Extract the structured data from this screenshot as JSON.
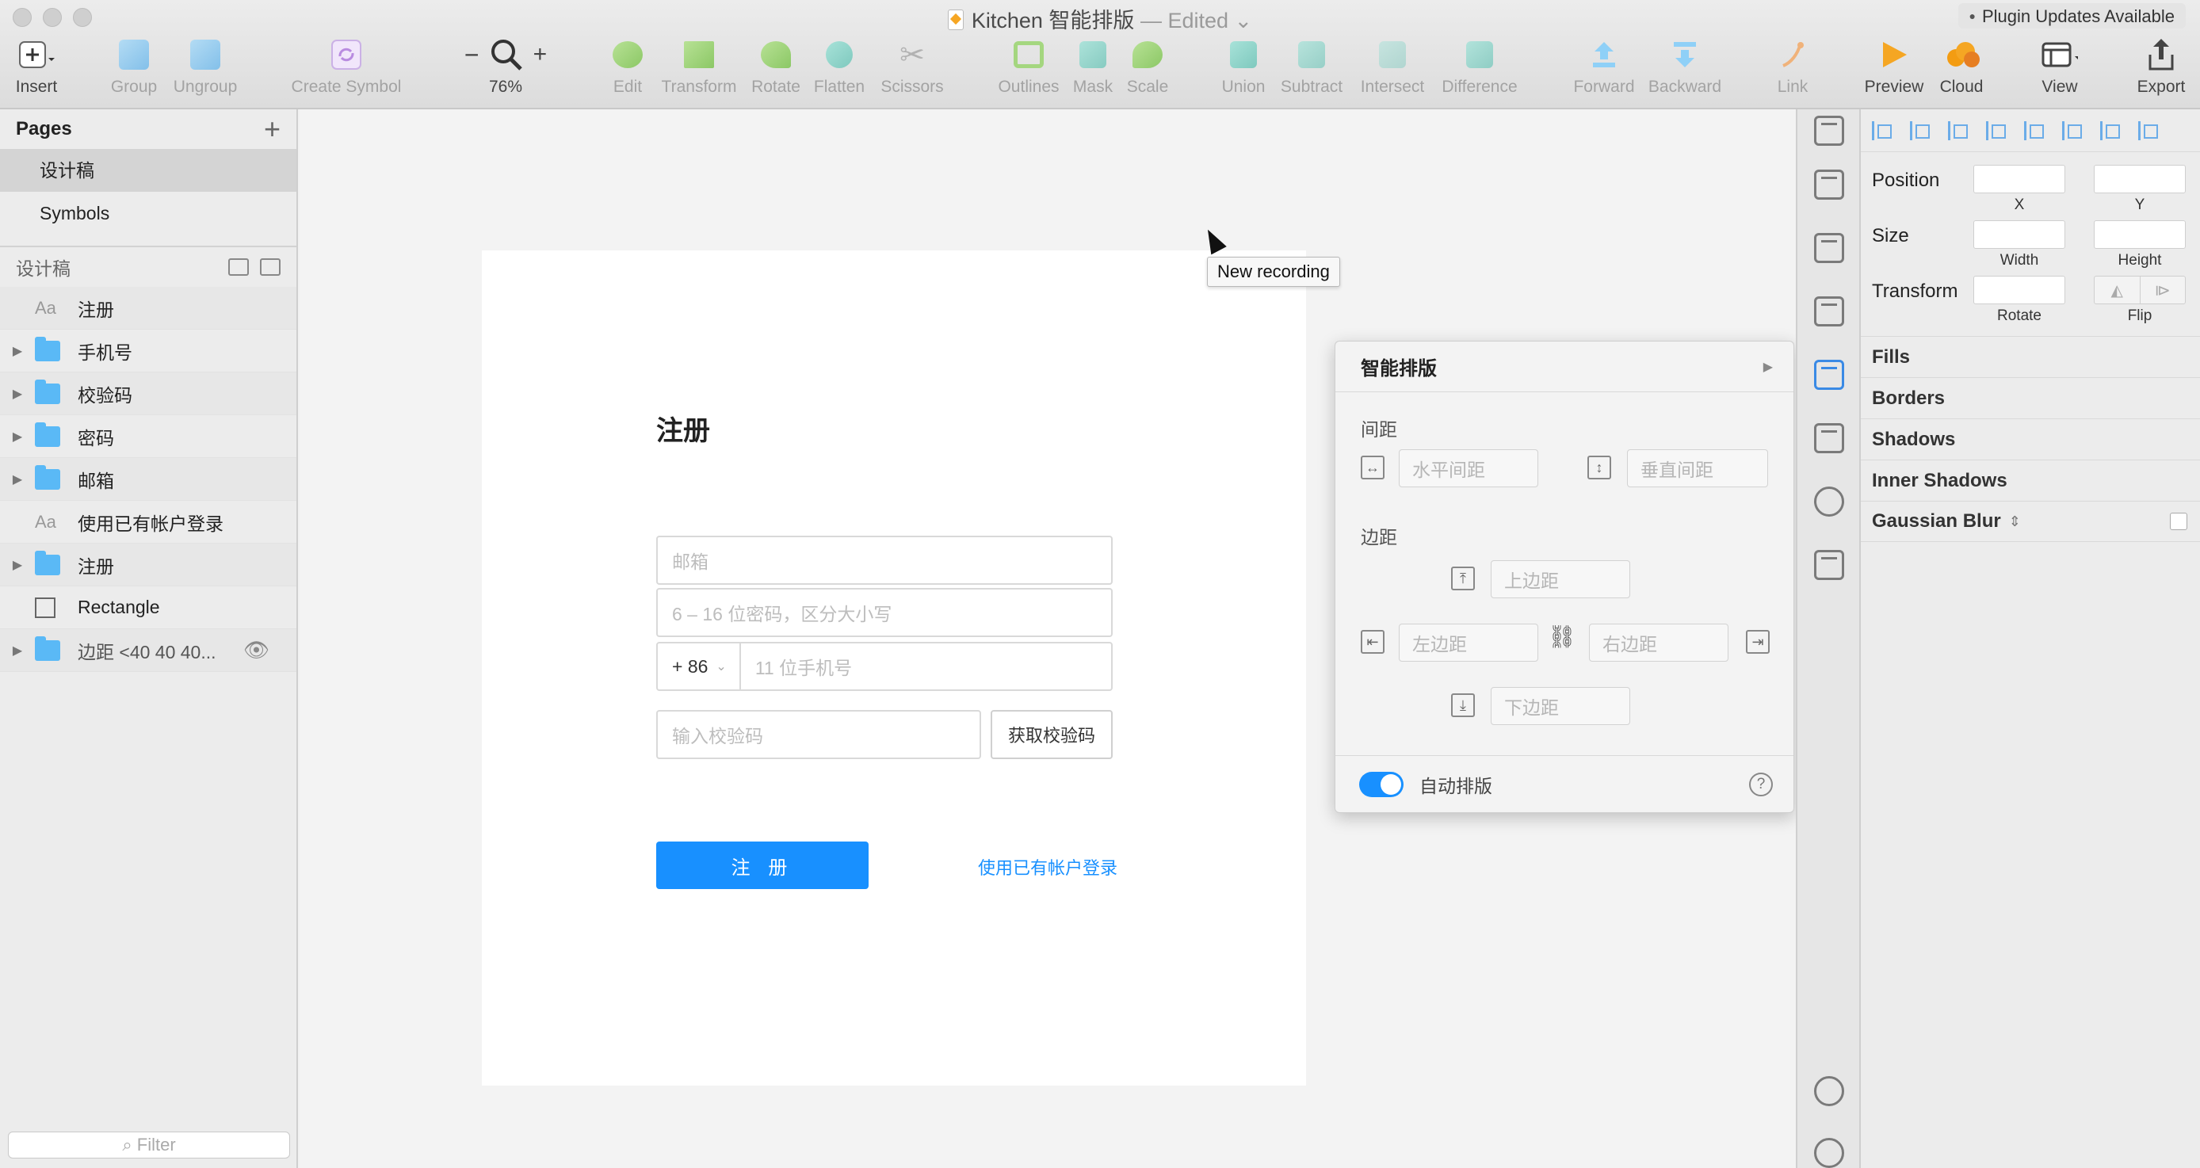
{
  "window": {
    "title": "Kitchen 智能排版",
    "edited": "— Edited",
    "plugin_updates": "Plugin Updates Available"
  },
  "toolbar": {
    "insert": "Insert",
    "group": "Group",
    "ungroup": "Ungroup",
    "create_symbol": "Create Symbol",
    "zoom_minus": "−",
    "zoom_plus": "+",
    "zoom_level": "76%",
    "edit": "Edit",
    "transform": "Transform",
    "rotate": "Rotate",
    "flatten": "Flatten",
    "scissors": "Scissors",
    "outlines": "Outlines",
    "mask": "Mask",
    "scale": "Scale",
    "union": "Union",
    "subtract": "Subtract",
    "intersect": "Intersect",
    "difference": "Difference",
    "forward": "Forward",
    "backward": "Backward",
    "link": "Link",
    "preview": "Preview",
    "cloud": "Cloud",
    "view": "View",
    "export": "Export"
  },
  "sidebar": {
    "pages_title": "Pages",
    "add": "+",
    "pages": [
      {
        "label": "设计稿",
        "selected": true
      },
      {
        "label": "Symbols",
        "selected": false
      }
    ],
    "layers_title": "设计稿",
    "layers": [
      {
        "label": "注册",
        "type": "text"
      },
      {
        "label": "手机号",
        "type": "group"
      },
      {
        "label": "校验码",
        "type": "group"
      },
      {
        "label": "密码",
        "type": "group"
      },
      {
        "label": "邮箱",
        "type": "group"
      },
      {
        "label": "使用已有帐户登录",
        "type": "text"
      },
      {
        "label": "注册",
        "type": "group"
      },
      {
        "label": "Rectangle",
        "type": "rectangle"
      },
      {
        "label": "边距 <40 40 40...",
        "type": "group"
      }
    ],
    "filter_placeholder": "Filter"
  },
  "artboard": {
    "title": "注册",
    "email_placeholder": "邮箱",
    "password_placeholder": "6 – 16 位密码，区分大小写",
    "country_code": "+ 86",
    "phone_placeholder": "11 位手机号",
    "code_placeholder": "输入校验码",
    "get_code": "获取校验码",
    "register": "注 册",
    "login_link": "使用已有帐户登录"
  },
  "tooltip": "New recording",
  "plugin_panel": {
    "title": "智能排版",
    "spacing_label": "间距",
    "horizontal_spacing": "水平间距",
    "vertical_spacing": "垂直间距",
    "margin_label": "边距",
    "top_margin": "上边距",
    "left_margin": "左边距",
    "right_margin": "右边距",
    "bottom_margin": "下边距",
    "auto_layout": "自动排版",
    "auto_layout_on": true,
    "help": "?"
  },
  "inspector": {
    "position": "Position",
    "x": "X",
    "y": "Y",
    "size": "Size",
    "width": "Width",
    "height": "Height",
    "transform": "Transform",
    "rotate": "Rotate",
    "flip": "Flip",
    "fills": "Fills",
    "borders": "Borders",
    "shadows": "Shadows",
    "inner_shadows": "Inner Shadows",
    "gaussian_blur": "Gaussian Blur"
  },
  "colors": {
    "accent": "#1890ff",
    "folder": "#5ab9f6",
    "preview_icon": "#f5a623"
  }
}
